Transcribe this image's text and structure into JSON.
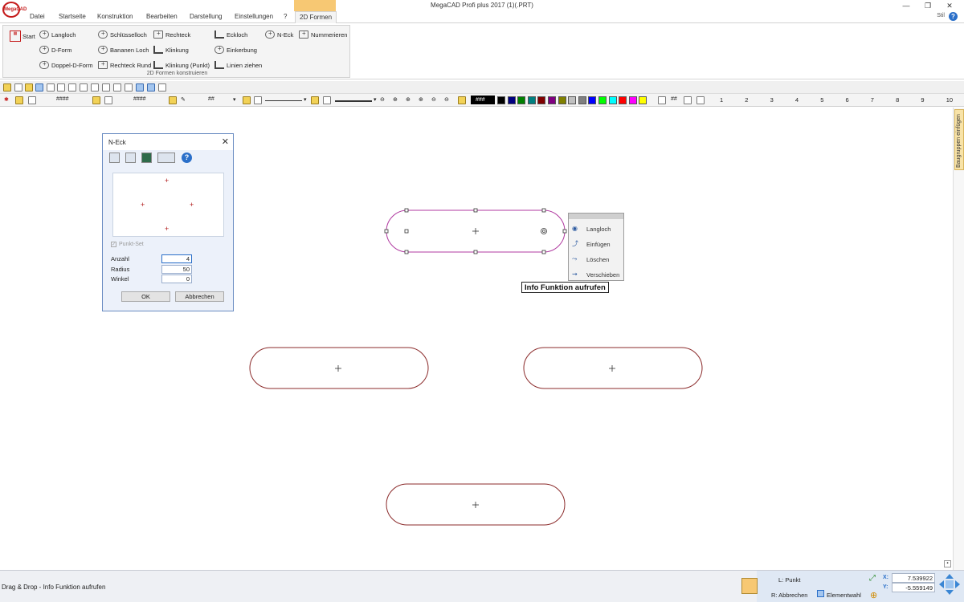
{
  "app": {
    "title": "MegaCAD Profi plus 2017  (1)(.PRT)",
    "logo_text": "MegaCAD",
    "window_controls": [
      "—",
      "❐",
      "✕"
    ]
  },
  "tabs": [
    {
      "label": "Datei",
      "active": false
    },
    {
      "label": "Startseite",
      "active": false
    },
    {
      "label": "Konstruktion",
      "active": false
    },
    {
      "label": "Bearbeiten",
      "active": false
    },
    {
      "label": "Darstellung",
      "active": false
    },
    {
      "label": "Einstellungen",
      "active": false
    },
    {
      "label": "?",
      "active": false
    },
    {
      "label": "2D Formen",
      "active": true
    }
  ],
  "tabs_right": {
    "stil": "Stil"
  },
  "ribbon": {
    "start": "Start",
    "group_label": "2D Formen konstruieren",
    "buttons": {
      "langloch": "Langloch",
      "d_form": "D-Form",
      "doppel_d_form": "Doppel-D-Form",
      "schluesselloch": "Schlüsselloch",
      "bananen_loch": "Bananen Loch",
      "rechteck_rund": "Rechteck Rund",
      "rechteck": "Rechteck",
      "klinkung": "Klinkung",
      "klinkung_punkt": "Klinkung (Punkt)",
      "eckloch": "Eckloch",
      "einkerbung": "Einkerbung",
      "linien_ziehen": "Linien ziehen",
      "n_eck": "N-Eck",
      "nummerieren": "Nummerieren"
    }
  },
  "toolbar2": {
    "field_a": "####",
    "field_b": "####",
    "field_c": "##",
    "field_d": "###",
    "hash_label": "##",
    "colors": [
      "#000000",
      "#000080",
      "#008000",
      "#008080",
      "#800000",
      "#800080",
      "#808000",
      "#c0c0c0",
      "#808080",
      "#0000ff",
      "#00ff00",
      "#00ffff",
      "#ff0000",
      "#ff00ff",
      "#ffff00"
    ],
    "numbers": [
      "1",
      "2",
      "3",
      "4",
      "5",
      "6",
      "7",
      "8",
      "9",
      "10"
    ]
  },
  "side_tab": {
    "label": "Baugruppen einfügen"
  },
  "dialog": {
    "title": "N-Eck",
    "punkt_set": "Punkt-Set",
    "fields": [
      {
        "label": "Anzahl",
        "value": "4"
      },
      {
        "label": "Radius",
        "value": "50"
      },
      {
        "label": "Winkel",
        "value": "0"
      }
    ],
    "ok": "OK",
    "cancel": "Abbrechen"
  },
  "context_menu": {
    "items": [
      {
        "label": "Langloch",
        "icon": "eye-icon"
      },
      {
        "label": "Einfügen",
        "icon": "insert-node-icon"
      },
      {
        "label": "Löschen",
        "icon": "delete-node-icon"
      },
      {
        "label": "Verschieben",
        "icon": "move-node-icon"
      }
    ]
  },
  "tooltip": "Info Funktion aufrufen",
  "status": {
    "message": "Drag & Drop - Info Funktion aufrufen",
    "left_click": "L: Punkt",
    "right_click": "R: Abbrechen",
    "elementwahl": "Elementwahl",
    "x_label": "X:",
    "y_label": "Y:",
    "x_value": "7.539922",
    "y_value": "-5.559149"
  },
  "colors": {
    "shape_stroke": "#8b2b2b",
    "selected_stroke": "#b03aa0",
    "accent": "#2a6fc9",
    "context_tab": "#f7c873"
  }
}
